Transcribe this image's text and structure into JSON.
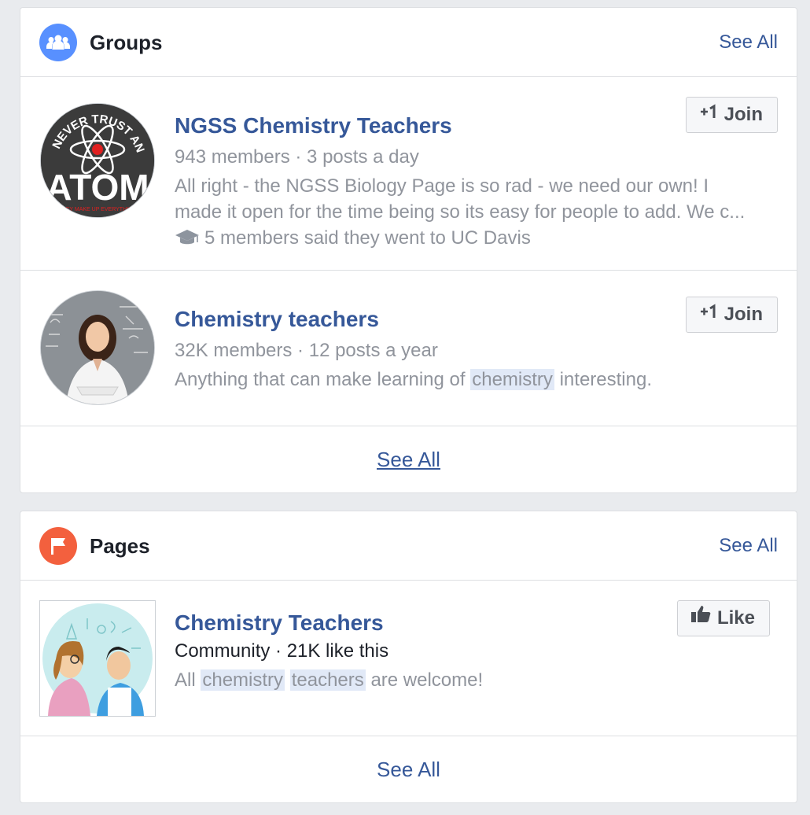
{
  "groups": {
    "title": "Groups",
    "icon": "groups-icon",
    "icon_color": "#5890ff",
    "see_all_label": "See All",
    "items": [
      {
        "name": "NGSS Chemistry Teachers",
        "meta": "943 members · 3 posts a day",
        "description_line1": "All right - the NGSS Biology Page is so rad - we need our own! I",
        "description_line2": "made it open for the time being so its easy for people to add. We c...",
        "note": "5 members said they went to UC Davis",
        "note_icon": "graduation-cap-icon",
        "button_label": "Join",
        "button_icon": "plus-one-icon",
        "avatar_text_top": "NEVER TRUST AN",
        "avatar_text_main": "ATOM",
        "avatar_text_bottom": "THEY MAKE UP EVERYTHING"
      },
      {
        "name": "Chemistry teachers",
        "meta": "32K members · 12 posts a year",
        "description_pre": "Anything that can make learning of",
        "description_highlight": "chemistry",
        "description_post": "interesting.",
        "button_label": "Join",
        "button_icon": "plus-one-icon"
      }
    ],
    "footer_see_all": "See All"
  },
  "pages": {
    "title": "Pages",
    "icon": "flag-icon",
    "icon_color": "#f3603e",
    "see_all_label": "See All",
    "items": [
      {
        "name": "Chemistry Teachers",
        "meta": "Community · 21K like this",
        "description_pre": "All",
        "description_highlight1": "chemistry",
        "description_highlight2": "teachers",
        "description_post": "are welcome!",
        "button_label": "Like",
        "button_icon": "thumbs-up-icon"
      }
    ],
    "footer_see_all": "See All"
  },
  "colors": {
    "link": "#365899",
    "secondary_text": "#90949c",
    "highlight": "#e1e9f7",
    "background": "#e9ebee"
  }
}
